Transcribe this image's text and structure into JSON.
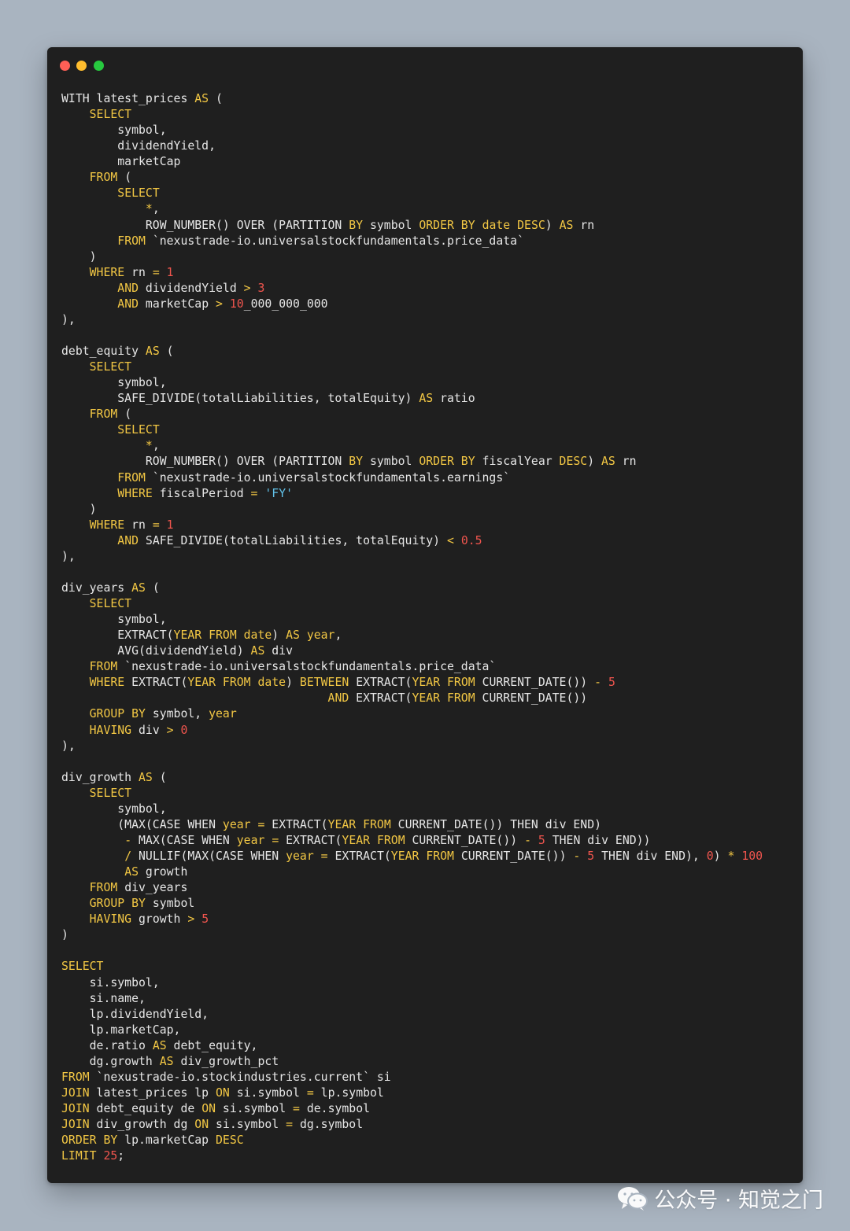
{
  "window": {
    "controls": {
      "close_color": "#ff5f56",
      "minimize_color": "#ffbd2e",
      "maximize_color": "#27c93f"
    }
  },
  "colors": {
    "background": "#a9b4c0",
    "editor_background": "#1f1f1f",
    "keyword": "#f2c744",
    "number": "#f0554e",
    "string": "#61c1e8",
    "plain": "#e6e6e6"
  },
  "code_lines": [
    [
      [
        "p",
        "WITH latest_prices "
      ],
      [
        "k",
        "AS"
      ],
      [
        "p",
        " ("
      ]
    ],
    [
      [
        "p",
        "    "
      ],
      [
        "k",
        "SELECT"
      ]
    ],
    [
      [
        "p",
        "        symbol,"
      ]
    ],
    [
      [
        "p",
        "        dividendYield,"
      ]
    ],
    [
      [
        "p",
        "        marketCap"
      ]
    ],
    [
      [
        "p",
        "    "
      ],
      [
        "k",
        "FROM"
      ],
      [
        "p",
        " ("
      ]
    ],
    [
      [
        "p",
        "        "
      ],
      [
        "k",
        "SELECT"
      ]
    ],
    [
      [
        "p",
        "            "
      ],
      [
        "k",
        "*"
      ],
      [
        "p",
        ","
      ]
    ],
    [
      [
        "p",
        "            ROW_NUMBER() OVER (PARTITION "
      ],
      [
        "k",
        "BY"
      ],
      [
        "p",
        " symbol "
      ],
      [
        "k",
        "ORDER BY"
      ],
      [
        "p",
        " "
      ],
      [
        "k",
        "date"
      ],
      [
        "p",
        " "
      ],
      [
        "k",
        "DESC"
      ],
      [
        "p",
        ") "
      ],
      [
        "k",
        "AS"
      ],
      [
        "p",
        " rn"
      ]
    ],
    [
      [
        "p",
        "        "
      ],
      [
        "k",
        "FROM"
      ],
      [
        "p",
        " `nexustrade-io.universalstockfundamentals.price_data`"
      ]
    ],
    [
      [
        "p",
        "    )"
      ]
    ],
    [
      [
        "p",
        "    "
      ],
      [
        "k",
        "WHERE"
      ],
      [
        "p",
        " rn "
      ],
      [
        "k",
        "="
      ],
      [
        "p",
        " "
      ],
      [
        "n",
        "1"
      ]
    ],
    [
      [
        "p",
        "        "
      ],
      [
        "k",
        "AND"
      ],
      [
        "p",
        " dividendYield "
      ],
      [
        "k",
        ">"
      ],
      [
        "p",
        " "
      ],
      [
        "n",
        "3"
      ]
    ],
    [
      [
        "p",
        "        "
      ],
      [
        "k",
        "AND"
      ],
      [
        "p",
        " marketCap "
      ],
      [
        "k",
        ">"
      ],
      [
        "p",
        " "
      ],
      [
        "n",
        "10"
      ],
      [
        "p",
        "_000_000_000"
      ]
    ],
    [
      [
        "p",
        "),"
      ]
    ],
    [
      [
        "p",
        ""
      ]
    ],
    [
      [
        "p",
        "debt_equity "
      ],
      [
        "k",
        "AS"
      ],
      [
        "p",
        " ("
      ]
    ],
    [
      [
        "p",
        "    "
      ],
      [
        "k",
        "SELECT"
      ]
    ],
    [
      [
        "p",
        "        symbol,"
      ]
    ],
    [
      [
        "p",
        "        SAFE_DIVIDE(totalLiabilities, totalEquity) "
      ],
      [
        "k",
        "AS"
      ],
      [
        "p",
        " ratio"
      ]
    ],
    [
      [
        "p",
        "    "
      ],
      [
        "k",
        "FROM"
      ],
      [
        "p",
        " ("
      ]
    ],
    [
      [
        "p",
        "        "
      ],
      [
        "k",
        "SELECT"
      ]
    ],
    [
      [
        "p",
        "            "
      ],
      [
        "k",
        "*"
      ],
      [
        "p",
        ","
      ]
    ],
    [
      [
        "p",
        "            ROW_NUMBER() OVER (PARTITION "
      ],
      [
        "k",
        "BY"
      ],
      [
        "p",
        " symbol "
      ],
      [
        "k",
        "ORDER BY"
      ],
      [
        "p",
        " fiscalYear "
      ],
      [
        "k",
        "DESC"
      ],
      [
        "p",
        ") "
      ],
      [
        "k",
        "AS"
      ],
      [
        "p",
        " rn"
      ]
    ],
    [
      [
        "p",
        "        "
      ],
      [
        "k",
        "FROM"
      ],
      [
        "p",
        " `nexustrade-io.universalstockfundamentals.earnings`"
      ]
    ],
    [
      [
        "p",
        "        "
      ],
      [
        "k",
        "WHERE"
      ],
      [
        "p",
        " fiscalPeriod "
      ],
      [
        "k",
        "="
      ],
      [
        "p",
        " "
      ],
      [
        "s",
        "'FY'"
      ]
    ],
    [
      [
        "p",
        "    )"
      ]
    ],
    [
      [
        "p",
        "    "
      ],
      [
        "k",
        "WHERE"
      ],
      [
        "p",
        " rn "
      ],
      [
        "k",
        "="
      ],
      [
        "p",
        " "
      ],
      [
        "n",
        "1"
      ]
    ],
    [
      [
        "p",
        "        "
      ],
      [
        "k",
        "AND"
      ],
      [
        "p",
        " SAFE_DIVIDE(totalLiabilities, totalEquity) "
      ],
      [
        "k",
        "<"
      ],
      [
        "p",
        " "
      ],
      [
        "n",
        "0.5"
      ]
    ],
    [
      [
        "p",
        "),"
      ]
    ],
    [
      [
        "p",
        ""
      ]
    ],
    [
      [
        "p",
        "div_years "
      ],
      [
        "k",
        "AS"
      ],
      [
        "p",
        " ("
      ]
    ],
    [
      [
        "p",
        "    "
      ],
      [
        "k",
        "SELECT"
      ]
    ],
    [
      [
        "p",
        "        symbol,"
      ]
    ],
    [
      [
        "p",
        "        EXTRACT("
      ],
      [
        "k",
        "YEAR FROM date"
      ],
      [
        "p",
        ") "
      ],
      [
        "k",
        "AS year"
      ],
      [
        "p",
        ","
      ]
    ],
    [
      [
        "p",
        "        AVG(dividendYield) "
      ],
      [
        "k",
        "AS"
      ],
      [
        "p",
        " div"
      ]
    ],
    [
      [
        "p",
        "    "
      ],
      [
        "k",
        "FROM"
      ],
      [
        "p",
        " `nexustrade-io.universalstockfundamentals.price_data`"
      ]
    ],
    [
      [
        "p",
        "    "
      ],
      [
        "k",
        "WHERE"
      ],
      [
        "p",
        " EXTRACT("
      ],
      [
        "k",
        "YEAR FROM date"
      ],
      [
        "p",
        ") "
      ],
      [
        "k",
        "BETWEEN"
      ],
      [
        "p",
        " EXTRACT("
      ],
      [
        "k",
        "YEAR FROM"
      ],
      [
        "p",
        " CURRENT_DATE()) "
      ],
      [
        "k",
        "-"
      ],
      [
        "p",
        " "
      ],
      [
        "n",
        "5"
      ]
    ],
    [
      [
        "p",
        "                                      "
      ],
      [
        "k",
        "AND"
      ],
      [
        "p",
        " EXTRACT("
      ],
      [
        "k",
        "YEAR FROM"
      ],
      [
        "p",
        " CURRENT_DATE())"
      ]
    ],
    [
      [
        "p",
        "    "
      ],
      [
        "k",
        "GROUP BY"
      ],
      [
        "p",
        " symbol, "
      ],
      [
        "k",
        "year"
      ]
    ],
    [
      [
        "p",
        "    "
      ],
      [
        "k",
        "HAVING"
      ],
      [
        "p",
        " div "
      ],
      [
        "k",
        ">"
      ],
      [
        "p",
        " "
      ],
      [
        "n",
        "0"
      ]
    ],
    [
      [
        "p",
        "),"
      ]
    ],
    [
      [
        "p",
        ""
      ]
    ],
    [
      [
        "p",
        "div_growth "
      ],
      [
        "k",
        "AS"
      ],
      [
        "p",
        " ("
      ]
    ],
    [
      [
        "p",
        "    "
      ],
      [
        "k",
        "SELECT"
      ]
    ],
    [
      [
        "p",
        "        symbol,"
      ]
    ],
    [
      [
        "p",
        "        (MAX(CASE WHEN "
      ],
      [
        "k",
        "year"
      ],
      [
        "p",
        " "
      ],
      [
        "k",
        "="
      ],
      [
        "p",
        " EXTRACT("
      ],
      [
        "k",
        "YEAR FROM"
      ],
      [
        "p",
        " CURRENT_DATE()) THEN div END)"
      ]
    ],
    [
      [
        "p",
        "         "
      ],
      [
        "k",
        "-"
      ],
      [
        "p",
        " MAX(CASE WHEN "
      ],
      [
        "k",
        "year"
      ],
      [
        "p",
        " "
      ],
      [
        "k",
        "="
      ],
      [
        "p",
        " EXTRACT("
      ],
      [
        "k",
        "YEAR FROM"
      ],
      [
        "p",
        " CURRENT_DATE()) "
      ],
      [
        "k",
        "-"
      ],
      [
        "p",
        " "
      ],
      [
        "n",
        "5"
      ],
      [
        "p",
        " THEN div END))"
      ]
    ],
    [
      [
        "p",
        "         "
      ],
      [
        "k",
        "/"
      ],
      [
        "p",
        " NULLIF(MAX(CASE WHEN "
      ],
      [
        "k",
        "year"
      ],
      [
        "p",
        " "
      ],
      [
        "k",
        "="
      ],
      [
        "p",
        " EXTRACT("
      ],
      [
        "k",
        "YEAR FROM"
      ],
      [
        "p",
        " CURRENT_DATE()) "
      ],
      [
        "k",
        "-"
      ],
      [
        "p",
        " "
      ],
      [
        "n",
        "5"
      ],
      [
        "p",
        " THEN div END), "
      ],
      [
        "n",
        "0"
      ],
      [
        "p",
        ") "
      ],
      [
        "k",
        "*"
      ],
      [
        "p",
        " "
      ],
      [
        "n",
        "100"
      ]
    ],
    [
      [
        "p",
        "         "
      ],
      [
        "k",
        "AS"
      ],
      [
        "p",
        " growth"
      ]
    ],
    [
      [
        "p",
        "    "
      ],
      [
        "k",
        "FROM"
      ],
      [
        "p",
        " div_years"
      ]
    ],
    [
      [
        "p",
        "    "
      ],
      [
        "k",
        "GROUP BY"
      ],
      [
        "p",
        " symbol"
      ]
    ],
    [
      [
        "p",
        "    "
      ],
      [
        "k",
        "HAVING"
      ],
      [
        "p",
        " growth "
      ],
      [
        "k",
        ">"
      ],
      [
        "p",
        " "
      ],
      [
        "n",
        "5"
      ]
    ],
    [
      [
        "p",
        ")"
      ]
    ],
    [
      [
        "p",
        ""
      ]
    ],
    [
      [
        "k",
        "SELECT"
      ]
    ],
    [
      [
        "p",
        "    si.symbol,"
      ]
    ],
    [
      [
        "p",
        "    si.name,"
      ]
    ],
    [
      [
        "p",
        "    lp.dividendYield,"
      ]
    ],
    [
      [
        "p",
        "    lp.marketCap,"
      ]
    ],
    [
      [
        "p",
        "    de.ratio "
      ],
      [
        "k",
        "AS"
      ],
      [
        "p",
        " debt_equity,"
      ]
    ],
    [
      [
        "p",
        "    dg.growth "
      ],
      [
        "k",
        "AS"
      ],
      [
        "p",
        " div_growth_pct"
      ]
    ],
    [
      [
        "k",
        "FROM"
      ],
      [
        "p",
        " `nexustrade-io.stockindustries.current` si"
      ]
    ],
    [
      [
        "k",
        "JOIN"
      ],
      [
        "p",
        " latest_prices lp "
      ],
      [
        "k",
        "ON"
      ],
      [
        "p",
        " si.symbol "
      ],
      [
        "k",
        "="
      ],
      [
        "p",
        " lp.symbol"
      ]
    ],
    [
      [
        "k",
        "JOIN"
      ],
      [
        "p",
        " debt_equity de "
      ],
      [
        "k",
        "ON"
      ],
      [
        "p",
        " si.symbol "
      ],
      [
        "k",
        "="
      ],
      [
        "p",
        " de.symbol"
      ]
    ],
    [
      [
        "k",
        "JOIN"
      ],
      [
        "p",
        " div_growth dg "
      ],
      [
        "k",
        "ON"
      ],
      [
        "p",
        " si.symbol "
      ],
      [
        "k",
        "="
      ],
      [
        "p",
        " dg.symbol"
      ]
    ],
    [
      [
        "k",
        "ORDER BY"
      ],
      [
        "p",
        " lp.marketCap "
      ],
      [
        "k",
        "DESC"
      ]
    ],
    [
      [
        "k",
        "LIMIT"
      ],
      [
        "p",
        " "
      ],
      [
        "n",
        "25"
      ],
      [
        "p",
        ";"
      ]
    ]
  ],
  "watermark": {
    "icon": "wechat-icon",
    "text": "公众号 · 知觉之门"
  }
}
